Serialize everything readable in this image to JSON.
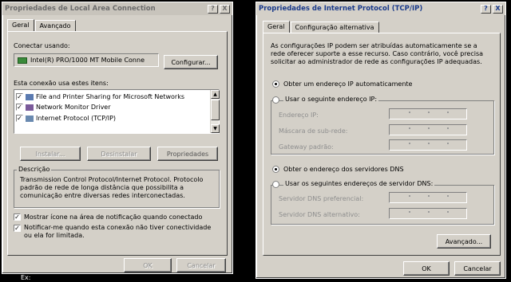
{
  "left_dialog": {
    "title": "Propriedades de Local Area Connection",
    "help_btn": "?",
    "close_btn": "X",
    "tabs": [
      "Geral",
      "Avançado"
    ],
    "connect_using_label": "Conectar usando:",
    "adapter_name": "Intel(R) PRO/1000 MT Mobile Conne",
    "configure_btn": "Configurar...",
    "items_label": "Esta conexão usa estes itens:",
    "items": [
      {
        "label": "File and Printer Sharing for Microsoft Networks",
        "checked": true
      },
      {
        "label": "Network Monitor Driver",
        "checked": true
      },
      {
        "label": "Internet Protocol (TCP/IP)",
        "checked": true
      }
    ],
    "install_btn": "Instalar...",
    "uninstall_btn": "Desinstalar",
    "properties_btn": "Propriedades",
    "description_title": "Descrição",
    "description_text": "Transmission Control Protocol/Internet Protocol. Protocolo padrão de rede de longa distância que possibilita a comunicação entre diversas redes interconectadas.",
    "show_icon_label": "Mostrar ícone na área de notificação quando conectado",
    "notify_label": "Notificar-me quando esta conexão não tiver conectividade ou ela for limitada.",
    "ok_btn": "OK",
    "cancel_btn": "Cancelar"
  },
  "right_dialog": {
    "title": "Propriedades de Internet Protocol (TCP/IP)",
    "help_btn": "?",
    "close_btn": "X",
    "tabs": [
      "Geral",
      "Configuração alternativa"
    ],
    "intro_text": "As configurações IP podem ser atribuídas automaticamente se a rede oferecer suporte a esse recurso. Caso contrário, você precisa solicitar ao administrador de rede as configurações IP adequadas.",
    "auto_ip_label": "Obter um endereço IP automaticamente",
    "manual_ip_label": "Usar o seguinte endereço IP:",
    "ip_address_label": "Endereço IP:",
    "subnet_label": "Máscara de sub-rede:",
    "gateway_label": "Gateway padrão:",
    "auto_dns_label": "Obter o endereço dos servidores DNS",
    "manual_dns_label": "Usar os seguintes endereços de servidor DNS:",
    "preferred_dns_label": "Servidor DNS preferencial:",
    "alternate_dns_label": "Servidor DNS alternativo:",
    "advanced_btn": "Avançado...",
    "ok_btn": "OK",
    "cancel_btn": "Cancelar"
  },
  "caption_text": "Ex:"
}
